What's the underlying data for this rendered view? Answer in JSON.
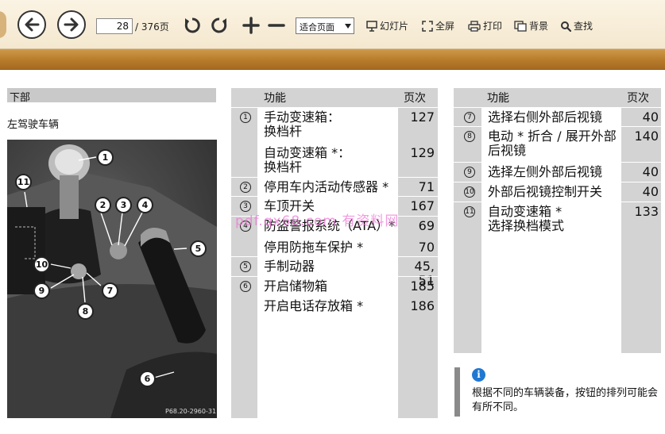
{
  "toolbar": {
    "page_current": "28",
    "page_total": "/ 376页",
    "zoom_value": "适合页面",
    "slideshow_label": "幻灯片",
    "fullscreen_label": "全屏",
    "print_label": "打印",
    "background_label": "背景",
    "find_label": "查找",
    "icons": [
      "back-arrow-icon",
      "forward-arrow-icon",
      "rotate-left-icon",
      "rotate-right-icon",
      "zoom-in-icon",
      "zoom-out-icon",
      "slideshow-icon",
      "fullscreen-icon",
      "print-icon",
      "background-icon",
      "search-icon"
    ]
  },
  "section": {
    "title": "下部",
    "subtitle": "左驾驶车辆"
  },
  "photo": {
    "callouts": [
      "1",
      "2",
      "3",
      "4",
      "5",
      "6",
      "7",
      "8",
      "9",
      "10",
      "11"
    ],
    "caption": "P68.20-2960-31"
  },
  "table_left": {
    "header_function": "功能",
    "header_page": "页次",
    "rows": [
      {
        "num": "1",
        "text": "手动变速箱：\n换档杆",
        "page": "127"
      },
      {
        "num": "",
        "text": "自动变速箱 *：\n换档杆",
        "page": "129"
      },
      {
        "num": "2",
        "text": "停用车内活动传感器 *",
        "page": "71"
      },
      {
        "num": "3",
        "text": "车顶开关",
        "page": "167"
      },
      {
        "num": "4",
        "text": "防盗警报系统（ATA）*",
        "page": "69"
      },
      {
        "num": "",
        "text": "停用防拖车保护 *",
        "page": "70"
      },
      {
        "num": "5",
        "text": "手制动器",
        "page": "45, 51"
      },
      {
        "num": "6",
        "text": "开启储物箱",
        "page": "185"
      },
      {
        "num": "",
        "text": "开启电话存放箱 *",
        "page": "186"
      }
    ]
  },
  "table_right": {
    "header_function": "功能",
    "header_page": "页次",
    "rows": [
      {
        "num": "7",
        "text": "选择右侧外部后视镜",
        "page": "40"
      },
      {
        "num": "8",
        "text": "电动 * 折合 / 展开外部\n后视镜",
        "page": "140"
      },
      {
        "num": "9",
        "text": "选择左侧外部后视镜",
        "page": "40"
      },
      {
        "num": "10",
        "text": "外部后视镜控制开关",
        "page": "40"
      },
      {
        "num": "11",
        "text": "自动变速箱 *\n选择换档模式",
        "page": "133"
      }
    ]
  },
  "watermark": "pdf.qx68.com 有资料网",
  "note": {
    "icon": "info-icon",
    "text": "根据不同的车辆装备，按钮的排列可能会有所不同。"
  },
  "colors": {
    "toolbar_bg": "#f4e8cf",
    "strip": "#b77b2b",
    "table_gray": "#d3d3d3",
    "info_blue": "#1f78d1",
    "watermark": "#ec7ad6"
  }
}
